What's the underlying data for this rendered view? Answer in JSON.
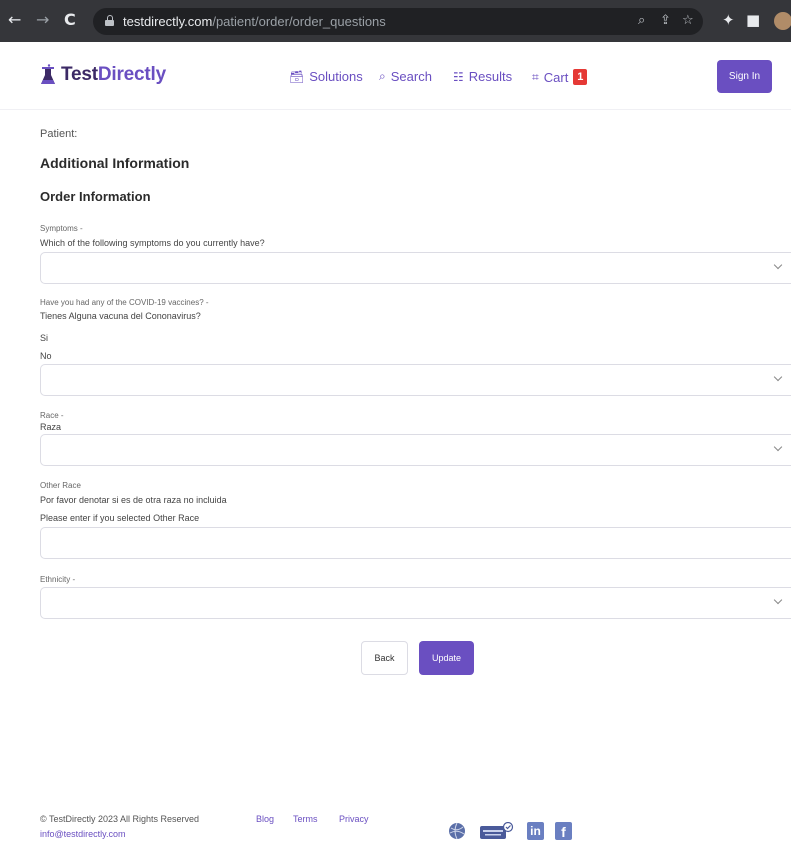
{
  "browser": {
    "back_icon": "←",
    "forward_icon": "→",
    "reload_icon": "C",
    "url_domain": "testdirectly.com",
    "url_path": "/patient/order/order_questions"
  },
  "header": {
    "logo_part1": "Test",
    "logo_part2": "Directly",
    "nav": [
      {
        "label": "Solutions"
      },
      {
        "label": "Search"
      },
      {
        "label": "Results"
      },
      {
        "label": "Cart"
      }
    ],
    "cart_count": "1",
    "signin_label": "Sign In"
  },
  "form": {
    "patient_label": "Patient:",
    "additional_title": "Additional Information",
    "order_title": "Order Information",
    "symptoms_label": "Symptoms -",
    "symptoms_question": "Which of the following symptoms do you currently have?",
    "vaccine_label": "Have you had any of the COVID-19 vaccines? -",
    "vaccine_question": "Tienes Alguna vacuna del Cononavirus?",
    "vaccine_opt_yes": "Si",
    "vaccine_opt_no": "No",
    "race_label": "Race -",
    "race_question": "Raza",
    "other_race_label": "Other Race",
    "other_race_question_es": "Por favor denotar si es de otra raza no incluida",
    "other_race_question_en": "Please enter if you selected Other Race",
    "ethnicity_label": "Ethnicity -",
    "back_label": "Back",
    "update_label": "Update"
  },
  "footer": {
    "copyright": "© TestDirectly 2023 All Rights Reserved",
    "email": "info@testdirectly.com",
    "links": [
      "Blog",
      "Terms",
      "Privacy"
    ],
    "linkedin": "in",
    "facebook": "f"
  },
  "colors": {
    "brand": "#6a4fc1",
    "badge": "#e53935",
    "chrome": "#35363a"
  }
}
